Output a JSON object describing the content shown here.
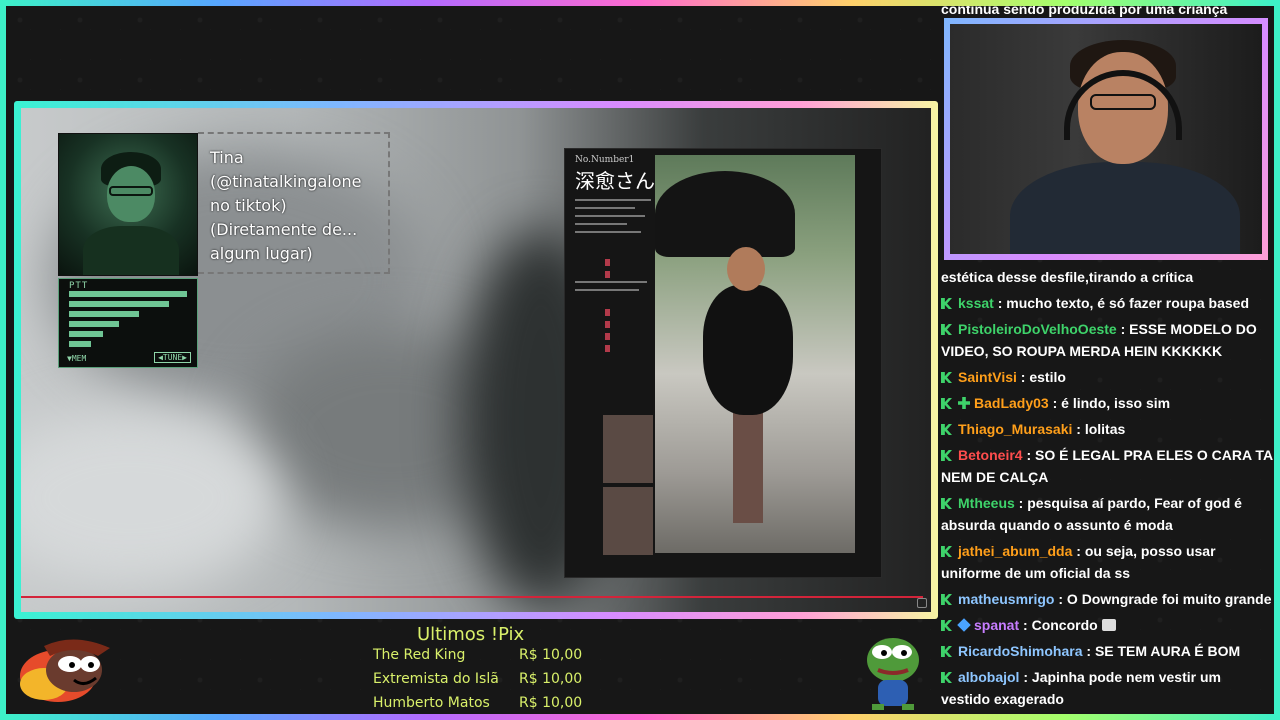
{
  "chat_top_text": "continua sendo produzida por uma criança",
  "codec": {
    "text": "Tina (@tinatalkingalone no tiktok) (Diretamente de... algum lugar)",
    "ptt": "PTT",
    "mem": "▼MEM",
    "tune": "◀TUNE▶"
  },
  "magazine": {
    "header": "No.Number1",
    "kanji": "深愈さん"
  },
  "chat": [
    {
      "user": "",
      "text": "estética desse desfile,tirando a crítica",
      "color": "#ffffff",
      "badges": []
    },
    {
      "user": "kssat",
      "text": "mucho texto, é só fazer roupa based",
      "color": "#3ed36a",
      "badges": [
        "k"
      ]
    },
    {
      "user": "PistoleiroDoVelhoOeste",
      "text": "ESSE MODELO DO VIDEO, SO ROUPA MERDA HEIN KKKKKK",
      "color": "#3ed36a",
      "badges": [
        "k"
      ]
    },
    {
      "user": "SaintVisi",
      "text": "estilo",
      "color": "#ff9f1a",
      "badges": [
        "k"
      ]
    },
    {
      "user": "BadLady03",
      "text": "é lindo, isso sim",
      "color": "#ff9f1a",
      "badges": [
        "k",
        "plus"
      ]
    },
    {
      "user": "Thiago_Murasaki",
      "text": "lolitas",
      "color": "#ff9f1a",
      "badges": [
        "k"
      ]
    },
    {
      "user": "Betoneir4",
      "text": "SO É LEGAL PRA ELES O CARA TA NEM DE CALÇA",
      "color": "#ff4d4d",
      "badges": [
        "k"
      ]
    },
    {
      "user": "Mtheeus",
      "text": "pesquisa aí pardo, Fear of god é absurda quando o assunto é moda",
      "color": "#3ed36a",
      "badges": [
        "k"
      ]
    },
    {
      "user": "jathei_abum_dda",
      "text": "ou seja, posso usar uniforme de um oficial da ss",
      "color": "#ff9f1a",
      "badges": [
        "k"
      ]
    },
    {
      "user": "matheusmrigo",
      "text": "O Downgrade foi muito grande",
      "color": "#8ec6ff",
      "badges": [
        "k"
      ]
    },
    {
      "user": "spanat",
      "text": "Concordo",
      "color": "#c77dff",
      "badges": [
        "k",
        "cube"
      ],
      "emote": true
    },
    {
      "user": "RicardoShimohara",
      "text": "SE TEM AURA É BOM",
      "color": "#8ec6ff",
      "badges": [
        "k"
      ]
    },
    {
      "user": "albobajol",
      "text": "Japinha pode nem vestir um vestido exagerado",
      "color": "#8ec6ff",
      "badges": [
        "k"
      ]
    }
  ],
  "pix": {
    "title": "Ultimos !Pix",
    "rows": [
      {
        "name": "The Red King",
        "amount": "R$ 10,00"
      },
      {
        "name": "Extremista do Islã",
        "amount": "R$ 10,00"
      },
      {
        "name": "Humberto Matos",
        "amount": "R$ 10,00"
      }
    ]
  }
}
